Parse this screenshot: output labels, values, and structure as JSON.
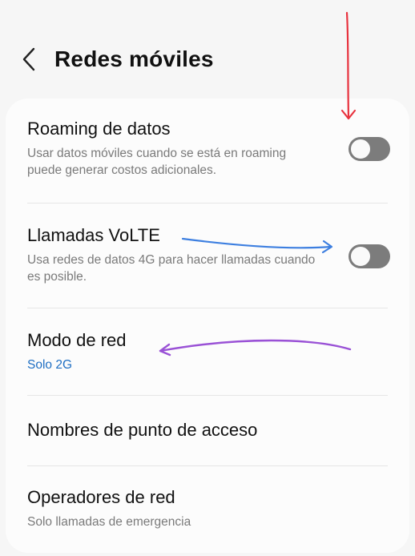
{
  "header": {
    "title": "Redes móviles",
    "back_icon": "chevron-left-icon"
  },
  "settings": [
    {
      "title": "Roaming de datos",
      "subtitle": "Usar datos móviles cuando se está en roaming puede generar costos adicionales.",
      "toggle": "off"
    },
    {
      "title": "Llamadas VoLTE",
      "subtitle": "Usa redes de datos 4G para hacer llamadas cuando es posible.",
      "toggle": "off"
    },
    {
      "title": "Modo de red",
      "subtitle": "Solo 2G"
    },
    {
      "title": "Nombres de punto de acceso"
    },
    {
      "title": "Operadores de red",
      "subtitle": "Solo llamadas de emergencia"
    }
  ],
  "colors": {
    "background": "#f6f6f6",
    "card": "#fcfcfc",
    "accent_value": "#1f6fc3",
    "toggle_off": "#7c7c7c",
    "annotation_red": "#e8333f",
    "annotation_blue": "#3d7fe0",
    "annotation_purple": "#9a52d6"
  }
}
